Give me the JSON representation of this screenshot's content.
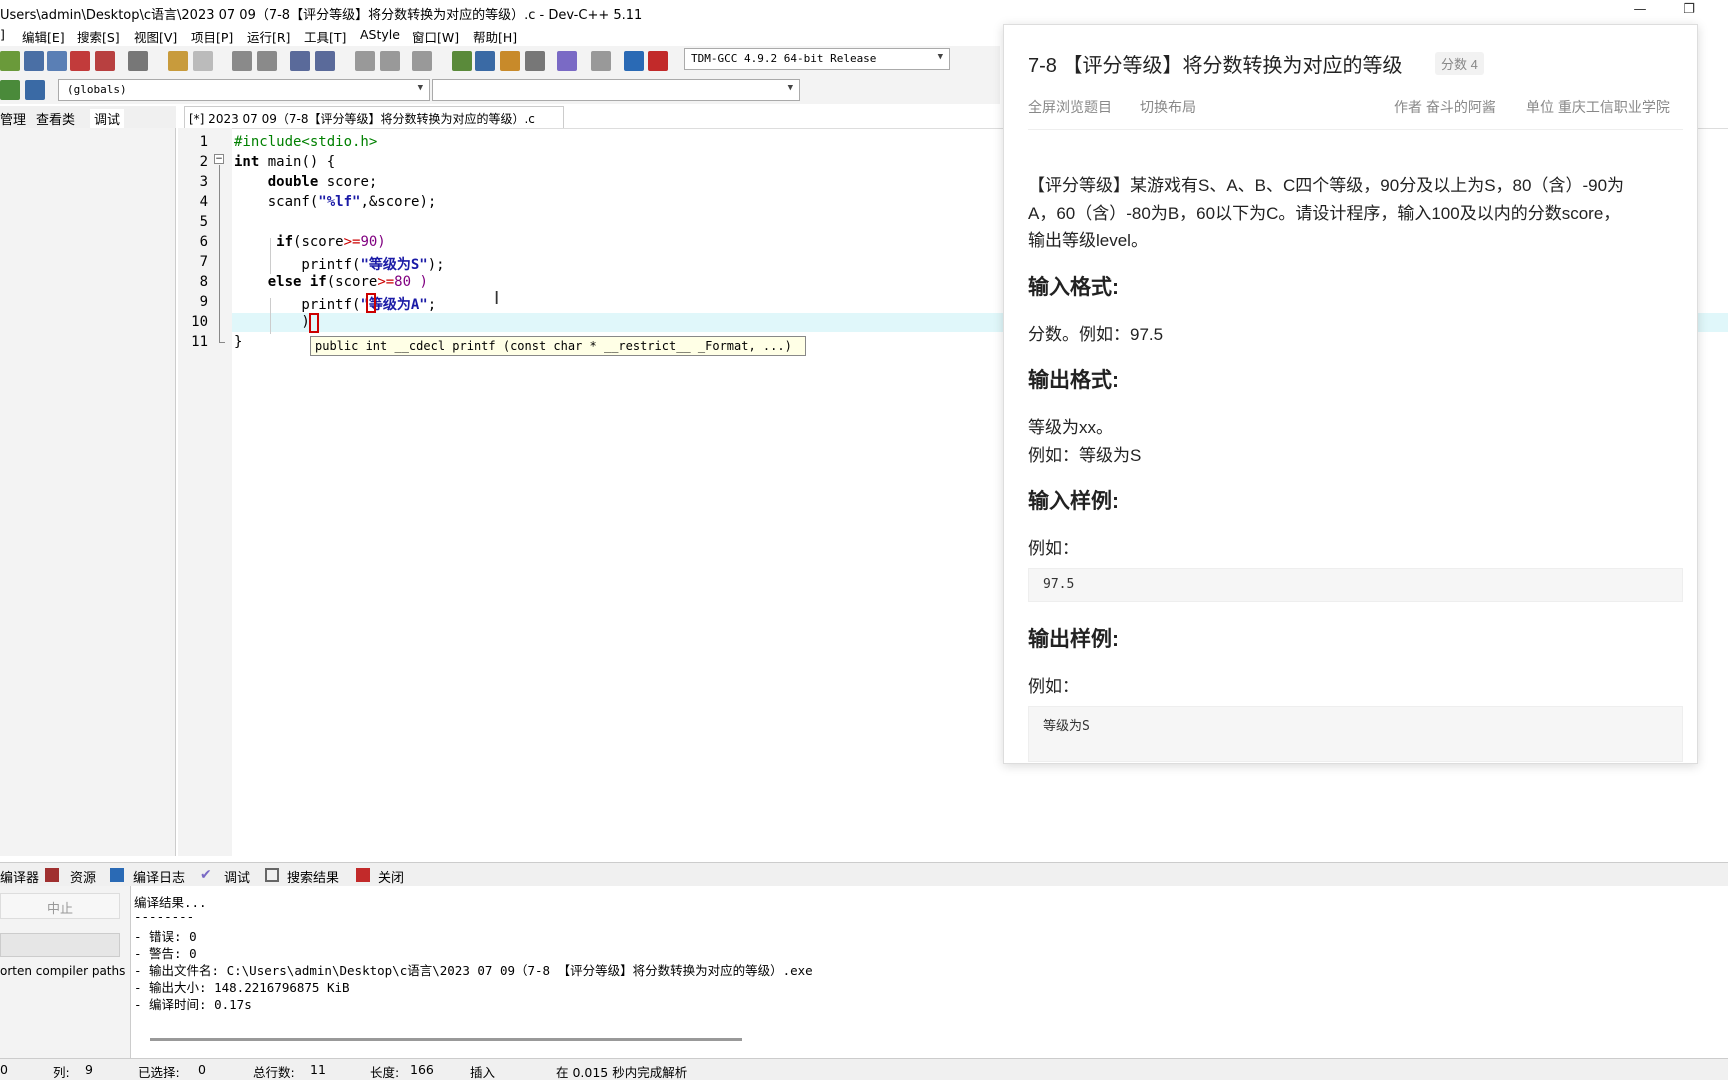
{
  "window": {
    "title": "Users\\admin\\Desktop\\c语言\\2023 07 09（7-8【评分等级】将分数转换为对应的等级）.c - Dev-C++ 5.11",
    "minimize": "—",
    "restore": "❐"
  },
  "menu": [
    "]",
    "编辑[E]",
    "搜索[S]",
    "视图[V]",
    "项目[P]",
    "运行[R]",
    "工具[T]",
    "AStyle",
    "窗口[W]",
    "帮助[H]"
  ],
  "toolbar": {
    "compiler": "TDM-GCC 4.9.2 64-bit Release",
    "scope": "(globals)",
    "symbol": ""
  },
  "left_tabs": [
    "管理",
    "查看类",
    "调试"
  ],
  "editor": {
    "tab": "[*] 2023 07 09（7-8【评分等级】将分数转换为对应的等级）.c",
    "line_numbers": [
      "1",
      "2",
      "3",
      "4",
      "5",
      "6",
      "7",
      "8",
      "9",
      "10",
      "11"
    ],
    "lines": [
      {
        "parts": [
          {
            "t": "#include<stdio.h>",
            "c": "pp"
          }
        ]
      },
      {
        "parts": [
          {
            "t": "int",
            "c": "kw"
          },
          {
            "t": " main() {",
            "c": ""
          }
        ]
      },
      {
        "parts": [
          {
            "t": "    ",
            "c": ""
          },
          {
            "t": "double",
            "c": "kw"
          },
          {
            "t": " score;",
            "c": ""
          }
        ]
      },
      {
        "parts": [
          {
            "t": "    scanf(",
            "c": ""
          },
          {
            "t": "\"%lf\"",
            "c": "str"
          },
          {
            "t": ",&score);",
            "c": ""
          }
        ]
      },
      {
        "parts": [
          {
            "t": "",
            "c": ""
          }
        ]
      },
      {
        "parts": [
          {
            "t": "     ",
            "c": ""
          },
          {
            "t": "if",
            "c": "kw"
          },
          {
            "t": "(score",
            "c": ""
          },
          {
            "t": ">=",
            "c": "op"
          },
          {
            "t": "90)",
            "c": "num"
          }
        ]
      },
      {
        "parts": [
          {
            "t": "        printf(",
            "c": ""
          },
          {
            "t": "\"等级为S\"",
            "c": "str"
          },
          {
            "t": ");",
            "c": ""
          }
        ]
      },
      {
        "parts": [
          {
            "t": "    ",
            "c": ""
          },
          {
            "t": "else if",
            "c": "kw"
          },
          {
            "t": "(score",
            "c": ""
          },
          {
            "t": ">=",
            "c": "op"
          },
          {
            "t": "80 )",
            "c": "num"
          }
        ]
      },
      {
        "parts": [
          {
            "t": "        printf(",
            "c": ""
          },
          {
            "t": "\"等级为A\"",
            "c": "str"
          },
          {
            "t": ";",
            "c": ""
          }
        ]
      },
      {
        "parts": [
          {
            "t": "        )",
            "c": ""
          }
        ]
      },
      {
        "parts": [
          {
            "t": "}",
            "c": ""
          }
        ]
      }
    ],
    "calltip": "public int __cdecl printf (const char * __restrict__ _Format, ...)"
  },
  "bottom_tabs": [
    "编译器",
    "资源",
    "编译日志",
    "调试",
    "搜索结果",
    "关闭"
  ],
  "bottom_left": {
    "stop": "中止",
    "shorten": "orten compiler paths"
  },
  "log_lines": [
    "编译结果...",
    "--------",
    "- 错误: 0",
    "- 警告: 0",
    "- 输出文件名: C:\\Users\\admin\\Desktop\\c语言\\2023 07 09（7-8 【评分等级】将分数转换为对应的等级）.exe",
    "- 输出大小: 148.2216796875 KiB",
    "- 编译时间: 0.17s"
  ],
  "status": {
    "line": "0",
    "col_label": "列:",
    "col": "9",
    "sel_label": "已选择:",
    "sel": "0",
    "total_label": "总行数:",
    "total": "11",
    "len_label": "长度:",
    "len": "166",
    "mode": "插入",
    "parse": "在 0.015 秒内完成解析"
  },
  "problem": {
    "title": "7-8 【评分等级】将分数转换为对应的等级",
    "score_badge": "分数 4",
    "fullscreen": "全屏浏览题目",
    "switch_layout": "切换布局",
    "author": "作者 奋斗的阿酱",
    "unit": "单位 重庆工信职业学院",
    "description_1": "【评分等级】某游戏有S、A、B、C四个等级，90分及以上为S，80（含）-90为",
    "description_2": "A，60（含）-80为B，60以下为C。请设计程序，输入100及以内的分数score，",
    "description_3": "输出等级level。",
    "input_format_heading": "输入格式:",
    "input_format": "分数。例如：97.5",
    "output_format_heading": "输出格式:",
    "output_format_1": "等级为xx。",
    "output_format_2": "例如：等级为S",
    "input_sample_heading": "输入样例:",
    "input_sample_label": "例如：",
    "input_sample": "97.5",
    "output_sample_heading": "输出样例:",
    "output_sample_label": "例如：",
    "output_sample": "等级为S"
  },
  "colors": {
    "current_line": "#e0f7fa",
    "string": "#1a1aa6",
    "preprocessor": "#008000",
    "operator": "#cc0000"
  }
}
